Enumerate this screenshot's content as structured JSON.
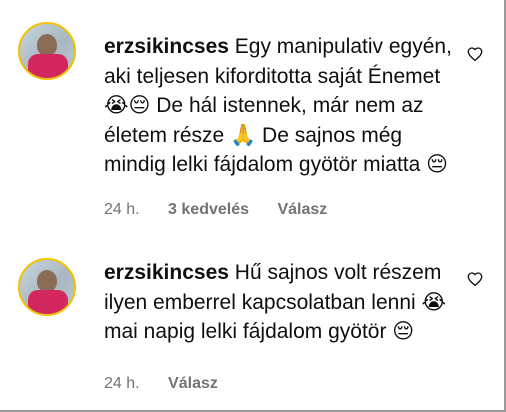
{
  "comments": [
    {
      "username": "erzsikincses",
      "text": "Egy manipulativ egyén, aki teljesen kiforditotta saját Énemet 😭😔 De hál istennek, már nem az életem része 🙏 De sajnos még mindig lelki fájdalom gyötör miatta 😔",
      "time": "24 h.",
      "likes": "3 kedvelés",
      "reply": "Válasz",
      "like_icon": "heart-outline-icon"
    },
    {
      "username": "erzsikincses",
      "text": "Hű sajnos volt részem ilyen emberrel kapcsolatban lenni 😭 mai napig lelki fájdalom gyötör 😔",
      "time": "24 h.",
      "reply": "Válasz",
      "like_icon": "heart-outline-icon"
    }
  ],
  "colors": {
    "text": "#0f0f0f",
    "meta": "#737373",
    "avatar_ring": "#f2c100"
  }
}
